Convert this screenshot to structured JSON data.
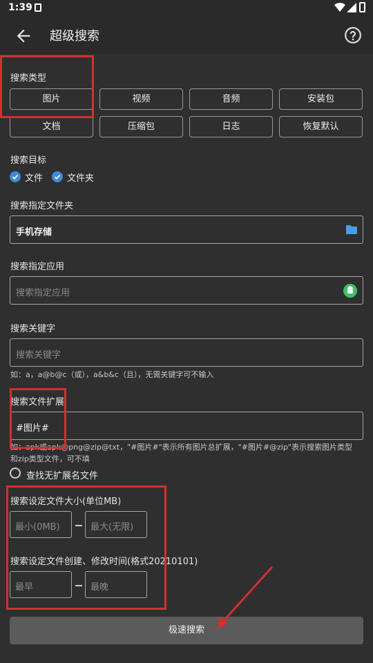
{
  "status": {
    "time": "1:39"
  },
  "appbar": {
    "title": "超级搜索"
  },
  "type_section": {
    "label": "搜索类型",
    "chips": [
      "图片",
      "视频",
      "音频",
      "安装包",
      "文档",
      "压缩包",
      "日志",
      "恢复默认"
    ]
  },
  "target_section": {
    "label": "搜索目标",
    "options": [
      {
        "label": "文件",
        "checked": true
      },
      {
        "label": "文件夹",
        "checked": true
      }
    ]
  },
  "folder_section": {
    "label": "搜索指定文件夹",
    "value": "手机存储"
  },
  "app_section": {
    "label": "搜索指定应用",
    "placeholder": "搜索指定应用"
  },
  "keyword_section": {
    "label": "搜索关键字",
    "placeholder": "搜索关键字",
    "hint": "如：a，a@b@c（或），a&b&c（且），无需关键字可不输入"
  },
  "ext_section": {
    "label": "搜索文件扩展",
    "value": "#图片#",
    "hint_line1": "如：apk或apk@png@zip@txt，\"#图片#\"表示所有图片总扩展，\"#图片#@zip\"表示搜索图片类型",
    "hint_line2": "和zip类型文件，可不填",
    "no_ext_label": "查找无扩展名文件"
  },
  "size_section": {
    "label": "搜索设定文件大小(单位MB)",
    "min_placeholder": "最小(0MB)",
    "max_placeholder": "最大(无限)"
  },
  "time_section": {
    "label": "搜索设定文件创建、修改时间(格式20210101)",
    "min_placeholder": "最早",
    "max_placeholder": "最晚"
  },
  "action": {
    "search_label": "极速搜索"
  },
  "colors": {
    "background": "#2f2f2f",
    "accent": "#3d8bd8",
    "highlight": "#d32f2f",
    "button": "#5b5b5b"
  }
}
